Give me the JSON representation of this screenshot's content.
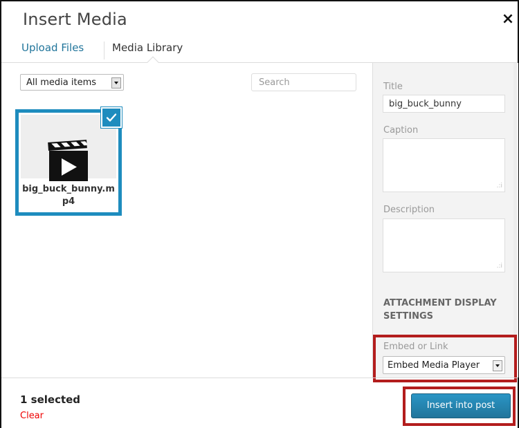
{
  "modal": {
    "title": "Insert Media",
    "close_symbol": "×",
    "tabs": [
      {
        "label": "Upload Files"
      },
      {
        "label": "Media Library"
      }
    ]
  },
  "toolbar": {
    "filter_value": "All media items",
    "search_placeholder": "Search"
  },
  "attachments": [
    {
      "filename": "big_buck_bunny.mp4",
      "icon": "video-clapperboard-icon",
      "selected": true
    }
  ],
  "details": {
    "title_label": "Title",
    "title_value": "big_buck_bunny",
    "caption_label": "Caption",
    "caption_value": "",
    "description_label": "Description",
    "description_value": "",
    "display_settings_heading": "ATTACHMENT DISPLAY SETTINGS",
    "embed_label": "Embed or Link",
    "embed_value": "Embed Media Player"
  },
  "footer": {
    "selected_count": "1 selected",
    "clear_label": "Clear",
    "insert_label": "Insert into post"
  },
  "colors": {
    "accent": "#1e8cbe",
    "link": "#21759b",
    "highlight": "#b31d1d",
    "clear": "#e00000"
  }
}
